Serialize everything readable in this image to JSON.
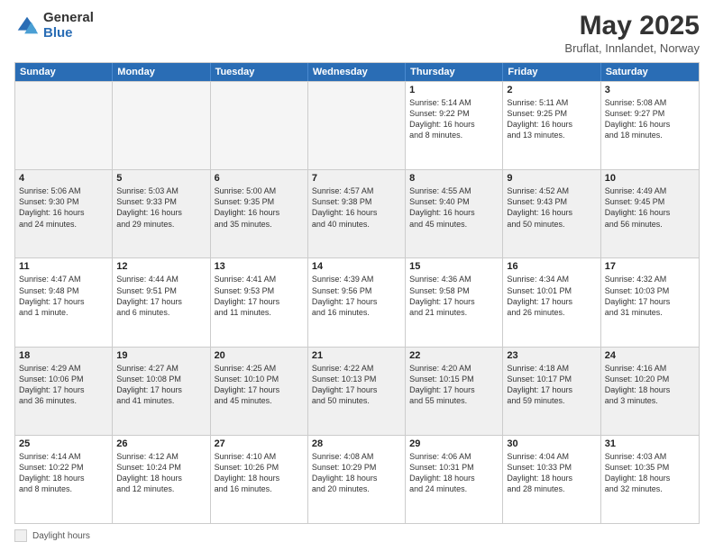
{
  "header": {
    "logo_general": "General",
    "logo_blue": "Blue",
    "title": "May 2025",
    "location": "Bruflat, Innlandet, Norway"
  },
  "calendar": {
    "days_of_week": [
      "Sunday",
      "Monday",
      "Tuesday",
      "Wednesday",
      "Thursday",
      "Friday",
      "Saturday"
    ],
    "rows": [
      [
        {
          "day": "",
          "info": "",
          "empty": true
        },
        {
          "day": "",
          "info": "",
          "empty": true
        },
        {
          "day": "",
          "info": "",
          "empty": true
        },
        {
          "day": "",
          "info": "",
          "empty": true
        },
        {
          "day": "1",
          "info": "Sunrise: 5:14 AM\nSunset: 9:22 PM\nDaylight: 16 hours\nand 8 minutes.",
          "empty": false
        },
        {
          "day": "2",
          "info": "Sunrise: 5:11 AM\nSunset: 9:25 PM\nDaylight: 16 hours\nand 13 minutes.",
          "empty": false
        },
        {
          "day": "3",
          "info": "Sunrise: 5:08 AM\nSunset: 9:27 PM\nDaylight: 16 hours\nand 18 minutes.",
          "empty": false
        }
      ],
      [
        {
          "day": "4",
          "info": "Sunrise: 5:06 AM\nSunset: 9:30 PM\nDaylight: 16 hours\nand 24 minutes.",
          "empty": false
        },
        {
          "day": "5",
          "info": "Sunrise: 5:03 AM\nSunset: 9:33 PM\nDaylight: 16 hours\nand 29 minutes.",
          "empty": false
        },
        {
          "day": "6",
          "info": "Sunrise: 5:00 AM\nSunset: 9:35 PM\nDaylight: 16 hours\nand 35 minutes.",
          "empty": false
        },
        {
          "day": "7",
          "info": "Sunrise: 4:57 AM\nSunset: 9:38 PM\nDaylight: 16 hours\nand 40 minutes.",
          "empty": false
        },
        {
          "day": "8",
          "info": "Sunrise: 4:55 AM\nSunset: 9:40 PM\nDaylight: 16 hours\nand 45 minutes.",
          "empty": false
        },
        {
          "day": "9",
          "info": "Sunrise: 4:52 AM\nSunset: 9:43 PM\nDaylight: 16 hours\nand 50 minutes.",
          "empty": false
        },
        {
          "day": "10",
          "info": "Sunrise: 4:49 AM\nSunset: 9:45 PM\nDaylight: 16 hours\nand 56 minutes.",
          "empty": false
        }
      ],
      [
        {
          "day": "11",
          "info": "Sunrise: 4:47 AM\nSunset: 9:48 PM\nDaylight: 17 hours\nand 1 minute.",
          "empty": false
        },
        {
          "day": "12",
          "info": "Sunrise: 4:44 AM\nSunset: 9:51 PM\nDaylight: 17 hours\nand 6 minutes.",
          "empty": false
        },
        {
          "day": "13",
          "info": "Sunrise: 4:41 AM\nSunset: 9:53 PM\nDaylight: 17 hours\nand 11 minutes.",
          "empty": false
        },
        {
          "day": "14",
          "info": "Sunrise: 4:39 AM\nSunset: 9:56 PM\nDaylight: 17 hours\nand 16 minutes.",
          "empty": false
        },
        {
          "day": "15",
          "info": "Sunrise: 4:36 AM\nSunset: 9:58 PM\nDaylight: 17 hours\nand 21 minutes.",
          "empty": false
        },
        {
          "day": "16",
          "info": "Sunrise: 4:34 AM\nSunset: 10:01 PM\nDaylight: 17 hours\nand 26 minutes.",
          "empty": false
        },
        {
          "day": "17",
          "info": "Sunrise: 4:32 AM\nSunset: 10:03 PM\nDaylight: 17 hours\nand 31 minutes.",
          "empty": false
        }
      ],
      [
        {
          "day": "18",
          "info": "Sunrise: 4:29 AM\nSunset: 10:06 PM\nDaylight: 17 hours\nand 36 minutes.",
          "empty": false
        },
        {
          "day": "19",
          "info": "Sunrise: 4:27 AM\nSunset: 10:08 PM\nDaylight: 17 hours\nand 41 minutes.",
          "empty": false
        },
        {
          "day": "20",
          "info": "Sunrise: 4:25 AM\nSunset: 10:10 PM\nDaylight: 17 hours\nand 45 minutes.",
          "empty": false
        },
        {
          "day": "21",
          "info": "Sunrise: 4:22 AM\nSunset: 10:13 PM\nDaylight: 17 hours\nand 50 minutes.",
          "empty": false
        },
        {
          "day": "22",
          "info": "Sunrise: 4:20 AM\nSunset: 10:15 PM\nDaylight: 17 hours\nand 55 minutes.",
          "empty": false
        },
        {
          "day": "23",
          "info": "Sunrise: 4:18 AM\nSunset: 10:17 PM\nDaylight: 17 hours\nand 59 minutes.",
          "empty": false
        },
        {
          "day": "24",
          "info": "Sunrise: 4:16 AM\nSunset: 10:20 PM\nDaylight: 18 hours\nand 3 minutes.",
          "empty": false
        }
      ],
      [
        {
          "day": "25",
          "info": "Sunrise: 4:14 AM\nSunset: 10:22 PM\nDaylight: 18 hours\nand 8 minutes.",
          "empty": false
        },
        {
          "day": "26",
          "info": "Sunrise: 4:12 AM\nSunset: 10:24 PM\nDaylight: 18 hours\nand 12 minutes.",
          "empty": false
        },
        {
          "day": "27",
          "info": "Sunrise: 4:10 AM\nSunset: 10:26 PM\nDaylight: 18 hours\nand 16 minutes.",
          "empty": false
        },
        {
          "day": "28",
          "info": "Sunrise: 4:08 AM\nSunset: 10:29 PM\nDaylight: 18 hours\nand 20 minutes.",
          "empty": false
        },
        {
          "day": "29",
          "info": "Sunrise: 4:06 AM\nSunset: 10:31 PM\nDaylight: 18 hours\nand 24 minutes.",
          "empty": false
        },
        {
          "day": "30",
          "info": "Sunrise: 4:04 AM\nSunset: 10:33 PM\nDaylight: 18 hours\nand 28 minutes.",
          "empty": false
        },
        {
          "day": "31",
          "info": "Sunrise: 4:03 AM\nSunset: 10:35 PM\nDaylight: 18 hours\nand 32 minutes.",
          "empty": false
        }
      ]
    ]
  },
  "footer": {
    "legend_label": "Daylight hours"
  }
}
